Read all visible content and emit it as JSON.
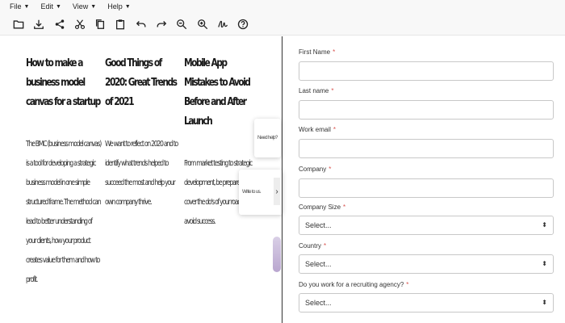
{
  "menubar": {
    "items": [
      {
        "label": "File"
      },
      {
        "label": "Edit"
      },
      {
        "label": "View"
      },
      {
        "label": "Help"
      }
    ]
  },
  "toolbar": {
    "icons": [
      "folder-icon",
      "download-icon",
      "share-icon",
      "cut-icon",
      "copy-icon",
      "paste-icon",
      "undo-icon",
      "redo-icon",
      "zoom-out-icon",
      "zoom-in-icon",
      "signature-icon",
      "help-icon"
    ]
  },
  "articles": [
    {
      "title": "How to make a business model canvas for a startup",
      "body": "The BMC (business model canvas) is a tool for developing a strategic business model in one simple structured frame. The method can lead to better understanding of your clients, how your product creates value for them and how to profit."
    },
    {
      "title": "Good Things of 2020: Great Trends of 2021",
      "body": "We want to reflect on 2020 and to identify what trends helped to succeed the most and help your own company thrive."
    },
    {
      "title": "Mobile App Mistakes to Avoid Before and After Launch",
      "body": "From market testing to strategic development, be prepared - we cover the do's of your roadmap to avoid success."
    }
  ],
  "popups": {
    "first_text": "Need help?",
    "second_text": "Write to us.",
    "chevron": "›"
  },
  "form": {
    "first_name": {
      "label": "First Name",
      "required_mark": "*",
      "value": ""
    },
    "last_name": {
      "label": "Last name",
      "required_mark": "*",
      "value": ""
    },
    "work_email": {
      "label": "Work email",
      "required_mark": "*",
      "value": ""
    },
    "company": {
      "label": "Company",
      "required_mark": "*",
      "value": ""
    },
    "company_size": {
      "label": "Company Size",
      "required_mark": "*",
      "selected": "Select..."
    },
    "country": {
      "label": "Country",
      "required_mark": "*",
      "selected": "Select..."
    },
    "recruiting_agency": {
      "label": "Do you work for a recruiting agency?",
      "required_mark": "*",
      "selected": "Select..."
    }
  },
  "colors": {
    "required": "#d9534f",
    "toolbar_bg": "#f8f8f8",
    "divider": "#333333"
  }
}
